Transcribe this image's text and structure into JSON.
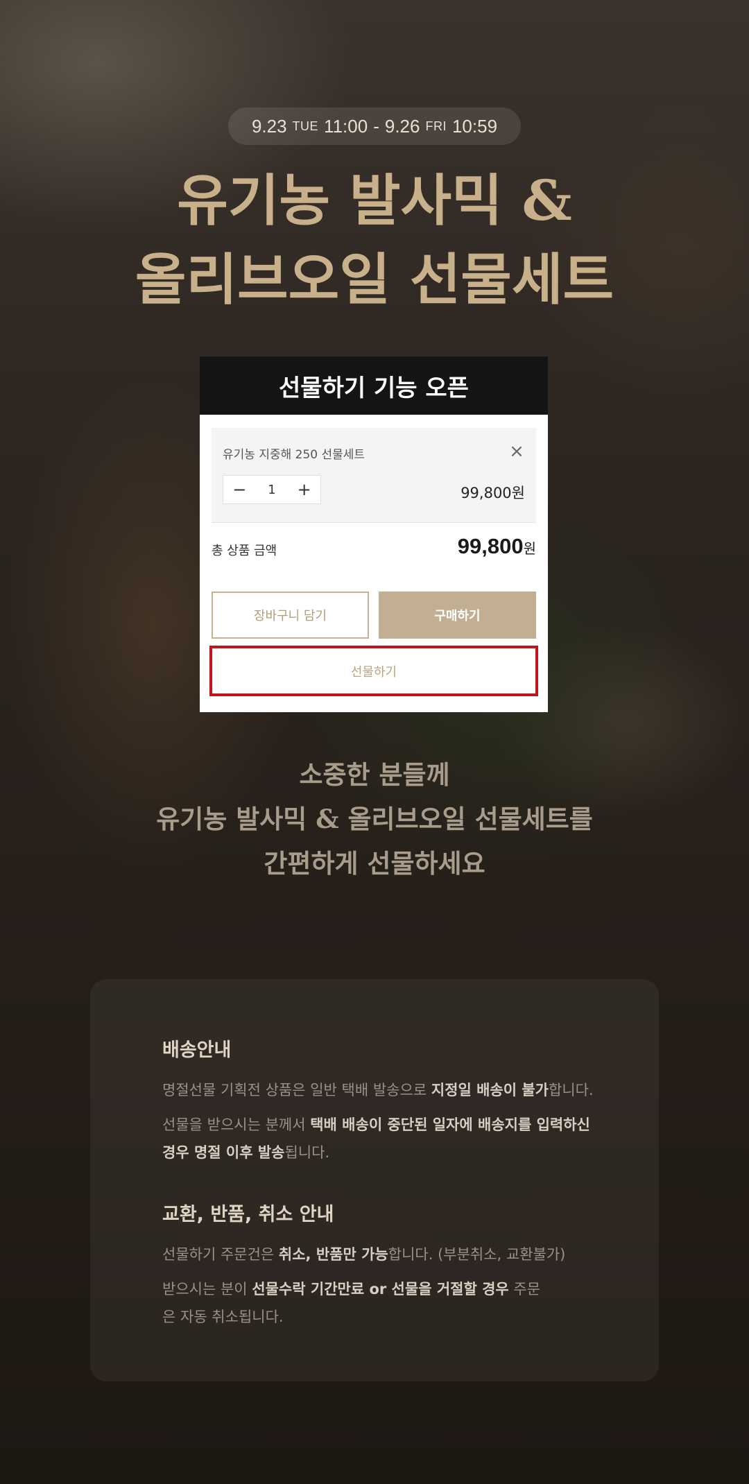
{
  "period": {
    "start_date": "9.23",
    "start_dow": "TUE",
    "start_time": "11:00",
    "separator": "-",
    "end_date": "9.26",
    "end_dow": "FRI",
    "end_time": "10:59"
  },
  "hero": {
    "title_line1": "유기농 발사믹 &",
    "title_line2": "올리브오일 선물세트"
  },
  "card": {
    "header": "선물하기 기능 오픈",
    "item_name": "유기농 지중해 250 선물세트",
    "close_icon": "×",
    "minus": "−",
    "quantity": "1",
    "plus": "+",
    "item_price": "99,800원",
    "total_label": "총 상품 금액",
    "total_amount": "99,800",
    "total_unit": "원",
    "cart_label": "장바구니 담기",
    "buy_label": "구매하기",
    "gift_label": "선물하기"
  },
  "subcopy": {
    "line1": "소중한 분들께",
    "line2": "유기농 발사믹 & 올리브오일 선물세트를",
    "line3": "간편하게 선물하세요"
  },
  "delivery": {
    "heading": "배송안내",
    "p1_a": "명절선물 기획전 상품은 일반 택배 발송으로 ",
    "p1_b": "지정일 배송이 불가",
    "p1_c": "합니다.",
    "p2_a": "선물을 받으시는 분께서 ",
    "p2_b": "택배 배송이 중단된 일자에 배송지를 입력하신 경우 명절 이후 발송",
    "p2_c": "됩니다."
  },
  "returns": {
    "heading": "교환, 반품, 취소 안내",
    "p1_a": "선물하기 주문건은 ",
    "p1_b": "취소, 반품만 가능",
    "p1_c": "합니다. (부분취소, 교환불가)",
    "p2_a": "받으시는 분이 ",
    "p2_b": "선물수락 기간만료 or 선물을 거절할 경우",
    "p2_c": " 주문은 자동 취소됩니다."
  },
  "colors": {
    "accent_gold": "#c8b08a",
    "buy_button": "#c2ae93",
    "gift_highlight_border": "#c4141b"
  }
}
